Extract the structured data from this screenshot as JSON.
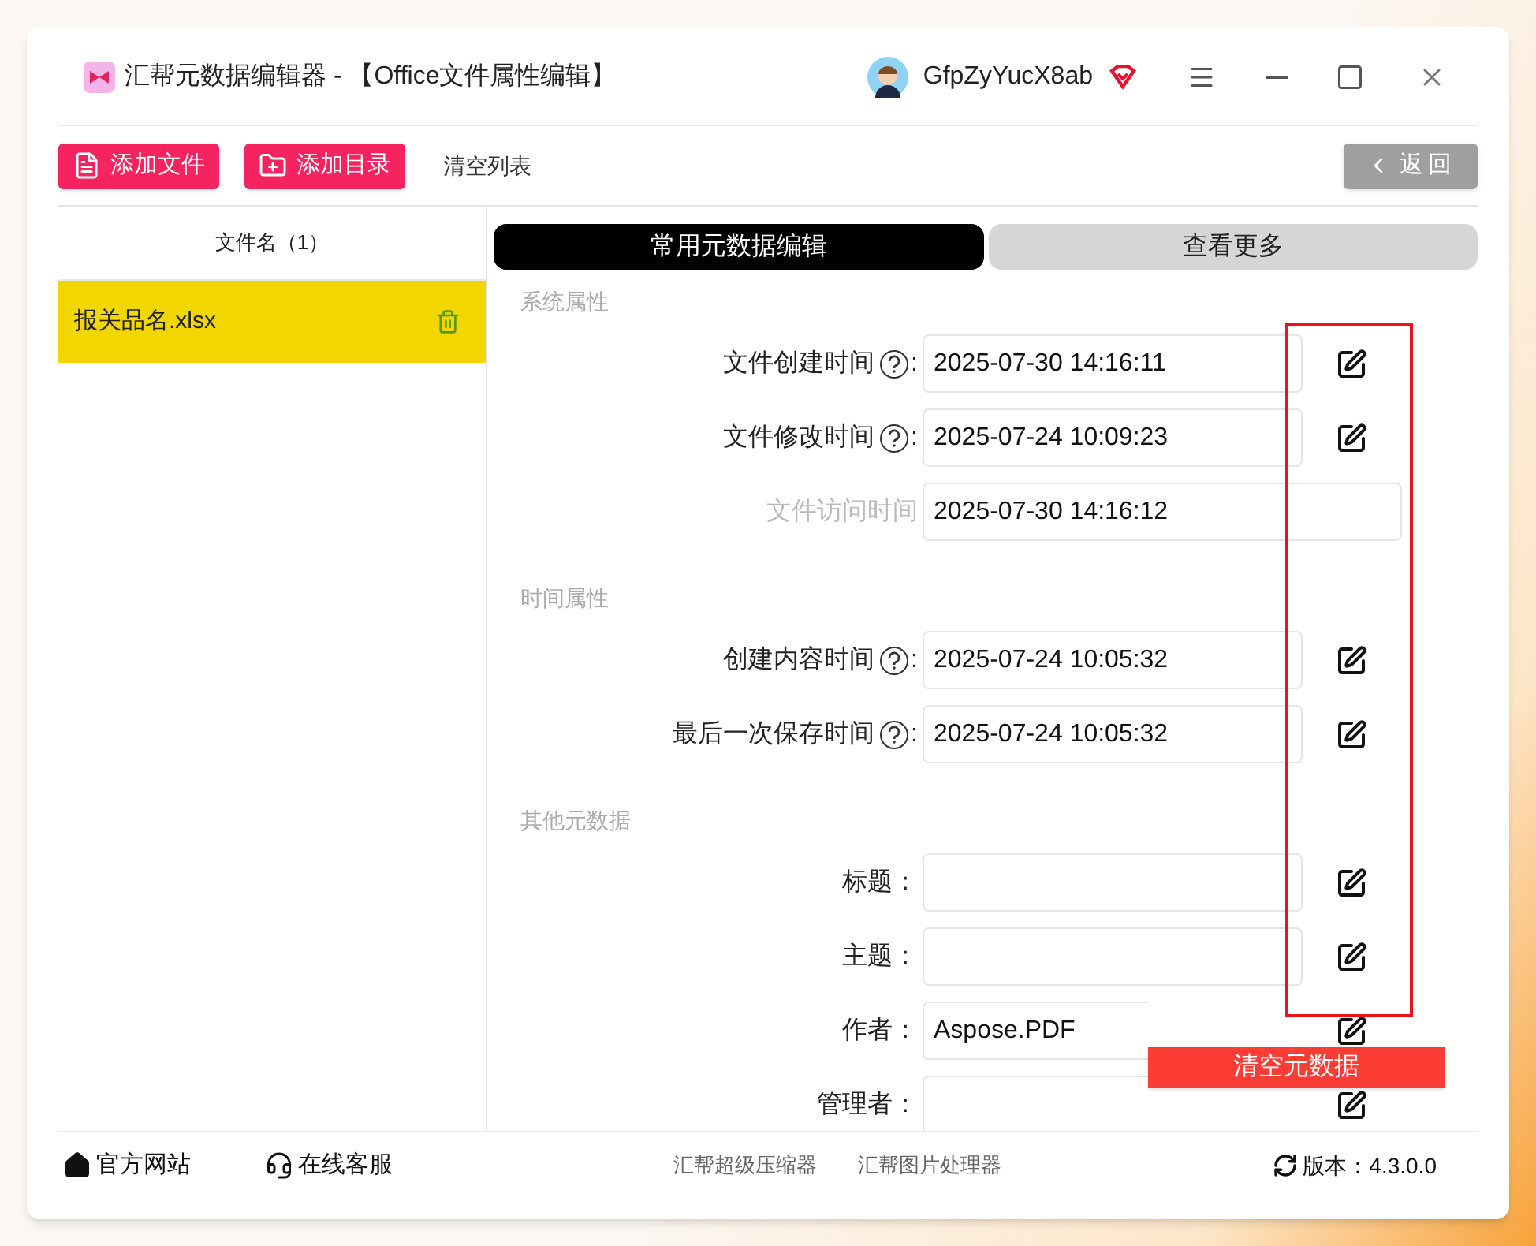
{
  "window": {
    "title": "汇帮元数据编辑器 - 【Office文件属性编辑】",
    "user": "GfpZyYucX8ab"
  },
  "toolbar": {
    "buttons": [
      {
        "label": "添加文件",
        "kind": "file"
      },
      {
        "label": "添加目录",
        "kind": "folder"
      }
    ],
    "clear_list": "清空列表",
    "back": "返回"
  },
  "file_list": {
    "header": "文件名（1）",
    "items": [
      {
        "name": "报关品名.xlsx",
        "selected": true
      }
    ]
  },
  "tabs": [
    {
      "label": "常用元数据编辑",
      "selected": true
    },
    {
      "label": "查看更多",
      "selected": false
    }
  ],
  "sections": [
    {
      "title": "系统属性",
      "fields": [
        {
          "label": "文件创建时间",
          "help": true,
          "suffix": ":",
          "value": "2025-07-30 14:16:11",
          "editable": true
        },
        {
          "label": "文件修改时间",
          "help": true,
          "suffix": ":",
          "value": "2025-07-24 10:09:23",
          "editable": true
        },
        {
          "label": "文件访问时间",
          "help": false,
          "value": "2025-07-30 14:16:12",
          "editable": false
        }
      ]
    },
    {
      "title": "时间属性",
      "fields": [
        {
          "label": "创建内容时间",
          "help": true,
          "suffix": ":",
          "value": "2025-07-24 10:05:32",
          "editable": true
        },
        {
          "label": "最后一次保存时间",
          "help": true,
          "suffix": ":",
          "value": "2025-07-24 10:05:32",
          "editable": true
        }
      ]
    },
    {
      "title": "其他元数据",
      "fields": [
        {
          "label": "标题：",
          "help": false,
          "editable": true
        },
        {
          "label": "主题：",
          "help": false,
          "editable": true
        },
        {
          "label": "作者：",
          "help": false,
          "value": "Aspose.PDF",
          "editable": true
        },
        {
          "label": "管理者：",
          "help": false,
          "editable": true
        }
      ]
    }
  ],
  "clear_metadata": "清空元数据",
  "footer": {
    "links": [
      {
        "label": "官方网站",
        "kind": "home"
      },
      {
        "label": "在线客服",
        "kind": "support"
      }
    ],
    "products": [
      "汇帮超级压缩器",
      "汇帮图片处理器"
    ],
    "version_label": "版本：",
    "version": "4.3.0.0"
  }
}
